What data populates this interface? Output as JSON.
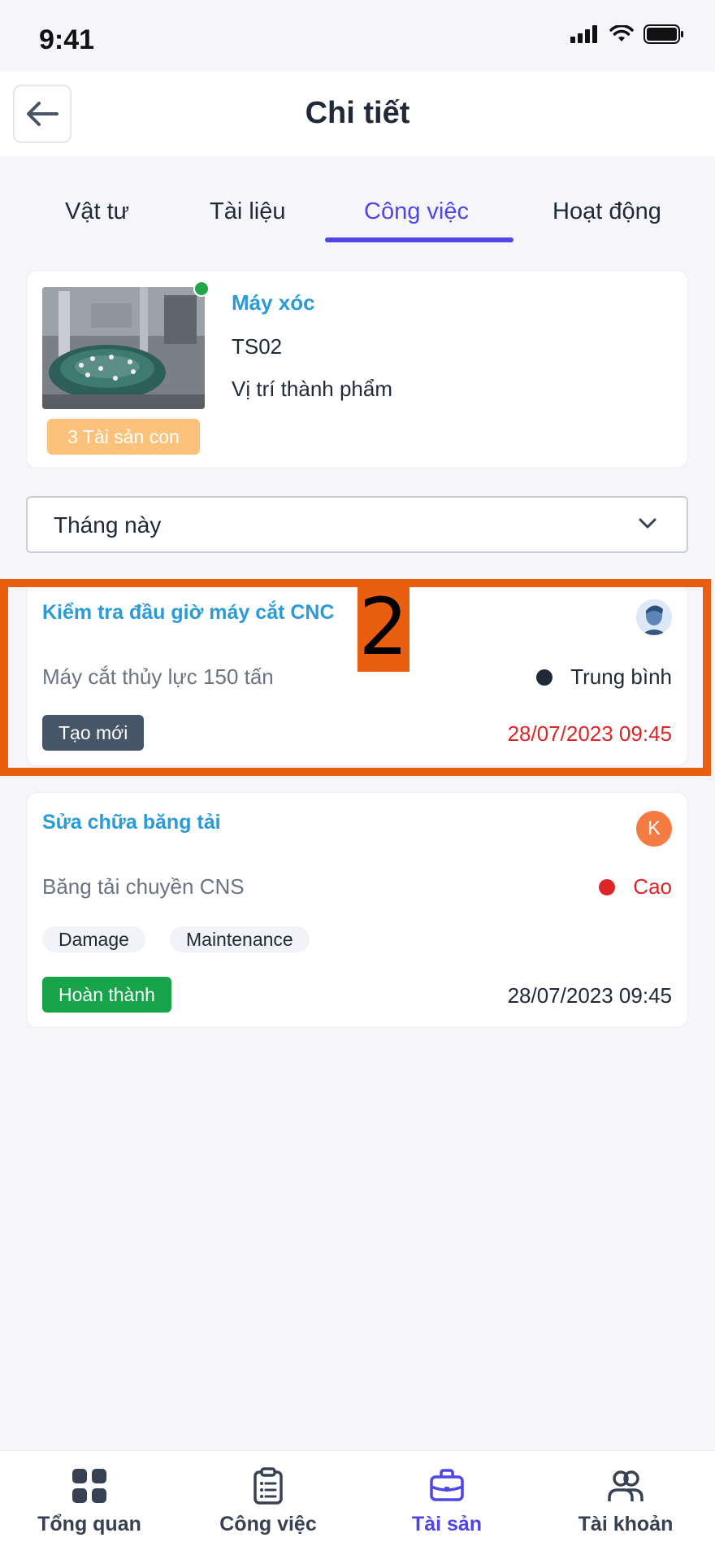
{
  "status_bar": {
    "time": "9:41"
  },
  "header": {
    "title": "Chi tiết"
  },
  "tabs": [
    {
      "label": "Vật tư"
    },
    {
      "label": "Tài liệu"
    },
    {
      "label": "Công việc",
      "active": true
    },
    {
      "label": "Hoạt động"
    }
  ],
  "asset": {
    "name": "Máy xóc",
    "code": "TS02",
    "location": "Vị trí thành phẩm",
    "children_badge": "3 Tài sản con",
    "online": true
  },
  "filter": {
    "value": "Tháng này"
  },
  "tasks": [
    {
      "title": "Kiểm tra đầu giờ máy cắt CNC",
      "asset": "Máy cắt thủy lực 150 tấn",
      "priority": "Trung bình",
      "priority_color": "#1F2937",
      "status": "Tạo mới",
      "status_color": "#475569",
      "date": "28/07/2023 09:45",
      "date_color": "#DC2626",
      "assignee": "avatar-photo"
    },
    {
      "title": "Sửa chữa băng tải",
      "asset": "Băng tải chuyền CNS",
      "priority": "Cao",
      "priority_color": "#DC2626",
      "tags": [
        "Damage",
        "Maintenance"
      ],
      "status": "Hoàn thành",
      "status_color": "#16A34A",
      "date": "28/07/2023 09:45",
      "date_color": "#1F2937",
      "assignee_initial": "K"
    }
  ],
  "annotation": {
    "number": "2",
    "color": "#EA5F0F"
  },
  "bottom_nav": [
    {
      "label": "Tổng quan",
      "icon": "grid-icon"
    },
    {
      "label": "Công việc",
      "icon": "clipboard-icon"
    },
    {
      "label": "Tài sản",
      "icon": "briefcase-icon",
      "active": true
    },
    {
      "label": "Tài khoản",
      "icon": "users-icon"
    }
  ],
  "colors": {
    "accent": "#4F46E5",
    "link": "#2B9BD8",
    "background": "#F5F5FA"
  }
}
